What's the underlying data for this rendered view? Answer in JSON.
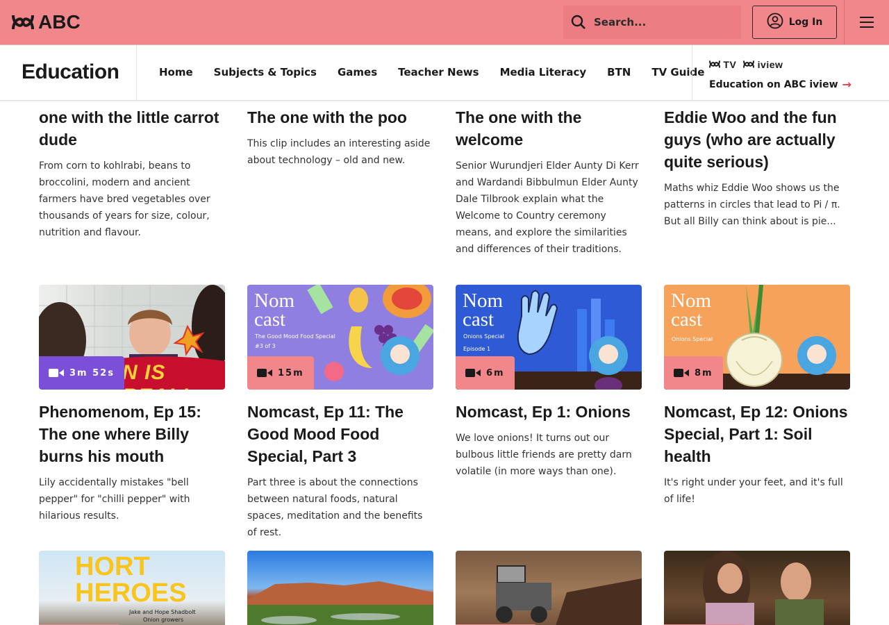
{
  "header": {
    "logo": "ABC",
    "search_placeholder": "Search...",
    "login_label": "Log In"
  },
  "nav": {
    "section_title": "Education",
    "links": [
      "Home",
      "Subjects & Topics",
      "Games",
      "Teacher News",
      "Media Literacy",
      "BTN",
      "TV Guide"
    ],
    "iview_logos": [
      "TV",
      "iview"
    ],
    "iview_link": "Education on ABC iview"
  },
  "colors": {
    "brand_pink": "#f2878b",
    "badge_purple": "#7b4fd8",
    "accent_red": "#e0414a"
  },
  "row1": [
    {
      "title": "one with the little carrot dude",
      "description": "From corn to kohlrabi, beans to broccolini, modern and ancient farmers have bred vegetables over thousands of years for size, colour, nutrition and flavour."
    },
    {
      "title": "The one with the poo",
      "description": "This clip includes an interesting aside about technology – old and new."
    },
    {
      "title": "The one with the welcome",
      "description": "Senior Wurundjeri Elder Aunty Di Kerr and Wardandi Bibbulmun Elder Aunty Dale Tilbrook explain what the Welcome to Country ceremony means, and explore the similarities and differences of their traditions."
    },
    {
      "title": "Eddie Woo and the fun guys (who are actually quite serious)",
      "description": "Maths whiz Eddie Woo shows us the patterns in circles that lead to Pi / π. But all Billy can think about is pie..."
    }
  ],
  "row2": [
    {
      "duration": "3m 52s",
      "thumb_text": "N IS REAL!",
      "title": "Phenomenom, Ep 15: The one where Billy burns his mouth",
      "description": "Lily accidentally mistakes \"bell pepper\" for \"chilli pepper\" with hilarious results."
    },
    {
      "duration": "15m",
      "thumb_text": "Nom cast",
      "thumb_sub": "The Good Mood Food Special",
      "thumb_sub2": "#3 of 3",
      "title": "Nomcast, Ep 11: The Good Mood Food Special, Part 3",
      "description": "Part three is about the connections between natural foods, natural spaces, meditation and the benefits of rest."
    },
    {
      "duration": "6m",
      "thumb_text": "Nom cast",
      "thumb_sub": "Onions Special",
      "thumb_sub2": "Episode 1",
      "title": "Nomcast, Ep 1: Onions",
      "description": "We love onions! It turns out our bulbous little friends are pretty darn volatile (in more ways than one)."
    },
    {
      "duration": "8m",
      "thumb_text": "Nom cast",
      "thumb_sub": "Onions Special",
      "title": "Nomcast, Ep 12: Onions Special, Part 1: Soil health",
      "description": "It's right under your feet, and it's full of life!"
    }
  ],
  "row3": [
    {
      "thumb_text": "HORT HEROES",
      "thumb_sub": "Jake and Hope Shadbolt",
      "thumb_sub2": "Onion growers"
    },
    {
      "thumb_text": ""
    },
    {
      "thumb_text": ""
    },
    {
      "thumb_text": ""
    }
  ]
}
